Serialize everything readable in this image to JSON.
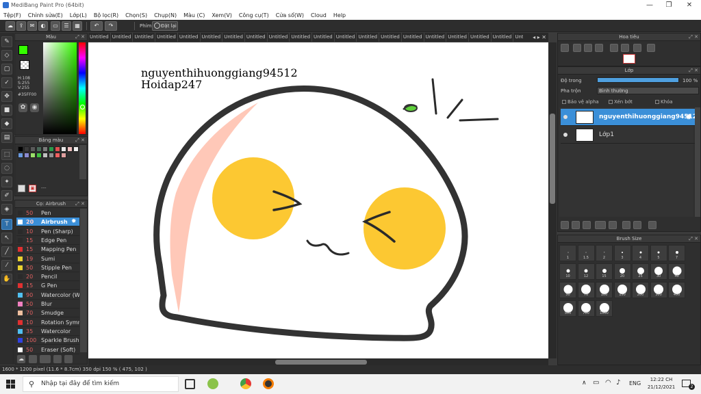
{
  "window": {
    "title": "MediBang Paint Pro (64bit)",
    "minimize": "—",
    "maximize": "❐",
    "close": "✕"
  },
  "menu": [
    "Tệp(F)",
    "Chỉnh sửa(E)",
    "Lớp(L)",
    "Bộ lọc(R)",
    "Chọn(S)",
    "Chụp(N)",
    "Màu (C)",
    "Xem(V)",
    "Công cụ(T)",
    "Cửa sổ(W)",
    "Cloud",
    "Help"
  ],
  "toolbar": {
    "phim_label": "Phím",
    "reset_label": "Đặt lại"
  },
  "color_panel": {
    "title": "Màu",
    "h": "H:108",
    "s": "S:255",
    "v": "V:255",
    "hex": "#35FF00",
    "main_color": "#35ff00"
  },
  "palette_panel": {
    "title": "Bảng màu",
    "colors": [
      "#000000",
      "#3a3a3a",
      "#5a5a5a",
      "#4a6a5a",
      "#7a7a7a",
      "#2a9a4a",
      "#e05050",
      "#e8e8e8",
      "#f0c0c0",
      "#f0f0f0",
      "#6a9adf",
      "#8a8acf",
      "#9adf6a",
      "#40c040",
      "#c0c0c0",
      "#909090",
      "#f06060",
      "#e0a0a0"
    ],
    "footer_text": "---"
  },
  "brush_panel": {
    "title": "Cọ: Airbrush",
    "brushes": [
      {
        "size": "50",
        "name": "Pen",
        "color": "#2a2a2a"
      },
      {
        "size": "20",
        "name": "Airbrush",
        "color": "#ffffff"
      },
      {
        "size": "10",
        "name": "Pen (Sharp)",
        "color": "#2a2a2a"
      },
      {
        "size": "15",
        "name": "Edge Pen",
        "color": "#2a2a2a"
      },
      {
        "size": "15",
        "name": "Mapping Pen",
        "color": "#e03030"
      },
      {
        "size": "19",
        "name": "Sumi",
        "color": "#e8d030"
      },
      {
        "size": "50",
        "name": "Stipple Pen",
        "color": "#e8d030"
      },
      {
        "size": "20",
        "name": "Pencil",
        "color": "#2a2a2a"
      },
      {
        "size": "15",
        "name": "G Pen",
        "color": "#e03030"
      },
      {
        "size": "90",
        "name": "Watercolor (We",
        "color": "#50c0f0"
      },
      {
        "size": "50",
        "name": "Blur",
        "color": "#f080c0"
      },
      {
        "size": "70",
        "name": "Smudge",
        "color": "#f0c0a0"
      },
      {
        "size": "10",
        "name": "Rotation Symm",
        "color": "#e03030"
      },
      {
        "size": "35",
        "name": "Watercolor",
        "color": "#50c0f0"
      },
      {
        "size": "100",
        "name": "Sparkle Brush",
        "color": "#3040e0"
      },
      {
        "size": "50",
        "name": "Eraser (Soft)",
        "color": "#ffffff"
      }
    ]
  },
  "tabs": [
    "Untitled",
    "Untitled",
    "Untitled",
    "Untitled",
    "Untitled",
    "Untitled",
    "Untitled",
    "Untitled",
    "Untitled",
    "Untitled",
    "Untitled",
    "Untitled",
    "Untitled",
    "Untitled",
    "Untitled",
    "Untitled",
    "Untitled",
    "Untitled",
    "Untitled",
    "Untitled",
    "Untitled",
    "Untitled",
    "Untitled",
    "Untitled"
  ],
  "canvas": {
    "username": "nguyenthihuonggiang94512",
    "site": "Hoidap247"
  },
  "navigator": {
    "title": "Hoa tiêu"
  },
  "layer_panel": {
    "title": "Lớp",
    "opacity_label": "Độ trong",
    "opacity_value": "100 %",
    "opacity": 100,
    "blend_label": "Pha trộn",
    "blend_value": "Bình thường",
    "protect_alpha": "Bảo vệ alpha",
    "clipping": "Xén bớt",
    "lock": "Khóa",
    "layers": [
      {
        "name": "nguyenthihuonggiang94512",
        "selected": true
      },
      {
        "name": "Lớp1",
        "selected": false
      }
    ]
  },
  "brush_size": {
    "title": "Brush Size",
    "sizes": [
      "1",
      "1.5",
      "2",
      "3",
      "4",
      "5",
      "7",
      "10",
      "12",
      "15",
      "20",
      "25",
      "30",
      "40",
      "50",
      "70",
      "100",
      "150",
      "200",
      "300",
      "400",
      "500",
      "700",
      "1000"
    ]
  },
  "status": {
    "text": "1600 * 1200 pixel    (11.6 * 8.7cm)    350 dpi    150 %    ( 475, 102 )"
  },
  "taskbar": {
    "search_placeholder": "Nhập tại đây để tìm kiếm",
    "lang": "ENG",
    "time": "12:22 CH",
    "date": "21/12/2021",
    "notif_count": "2"
  }
}
